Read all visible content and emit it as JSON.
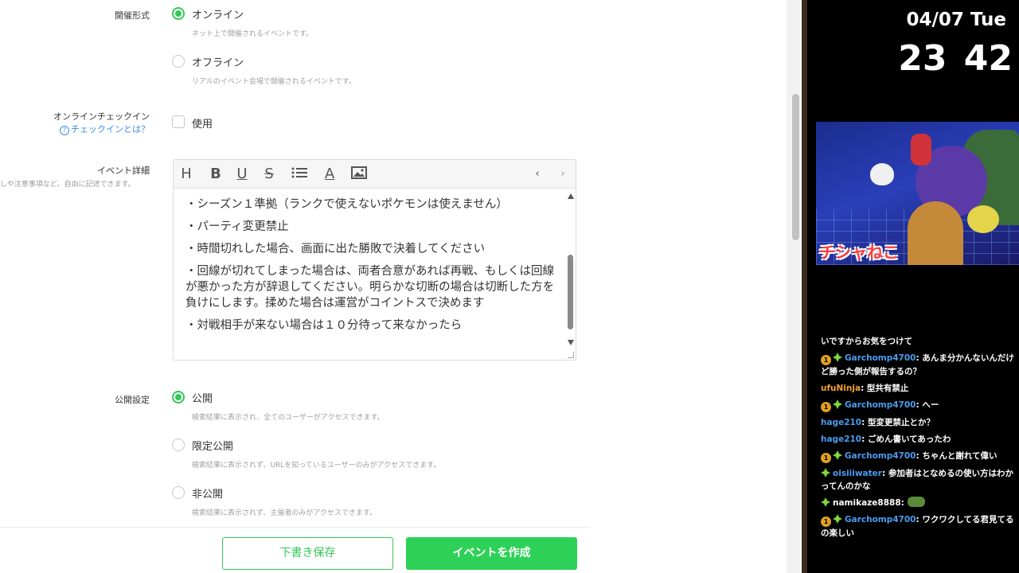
{
  "form": {
    "format_label": "開催形式",
    "format_options": [
      {
        "label": "オンライン",
        "desc": "ネット上で開催されるイベントです。",
        "selected": true
      },
      {
        "label": "オフライン",
        "desc": "リアルのイベント会場で開催されるイベントです。",
        "selected": false
      }
    ],
    "checkin_label": "オンラインチェックイン",
    "checkin_help": "チェックインとは？",
    "checkin_option": "使用",
    "detail_label": "イベント詳細",
    "detail_hint": "しや注意事項など、自由に記述できます。",
    "editor_content": [
      "・シーズン１準拠（ランクで使えないポケモンは使えません）",
      "・パーティ変更禁止",
      "・時間切れした場合、画面に出た勝敗で決着してください",
      "・回線が切れてしまった場合は、両者合意があれば再戦、もしくは回線が悪かった方が辞退してください。明らかな切断の場合は切断した方を負けにします。揉めた場合は運営がコイントスで決めます",
      "・対戦相手が来ない場合は１０分待って来なかったら"
    ],
    "visibility_label": "公開設定",
    "visibility_options": [
      {
        "label": "公開",
        "desc": "検索結果に表示され、全てのユーザーがアクセスできます。",
        "selected": true
      },
      {
        "label": "限定公開",
        "desc": "検索結果に表示されず、URLを知っているユーザーのみがアクセスできます。",
        "selected": false
      },
      {
        "label": "非公開",
        "desc": "検索結果に表示されず、主催者のみがアクセスできます。",
        "selected": false
      }
    ],
    "draft_button": "下書き保存",
    "create_button": "イベントを作成"
  },
  "toolbar_icons": [
    "heading-icon",
    "bold-icon",
    "underline-icon",
    "strikethrough-icon",
    "list-icon",
    "text-color-icon",
    "image-icon",
    "undo-icon",
    "redo-icon"
  ],
  "toolbar_glyphs": {
    "heading": "H",
    "bold": "B",
    "underline": "U",
    "strike": "S",
    "text_color": "A",
    "undo": "‹",
    "redo": "›"
  },
  "overlay": {
    "date": "04/07 Tue",
    "time": "23 42",
    "art_title": "チシャねこ"
  },
  "chat": [
    {
      "badge": "",
      "user": "",
      "text": "いですからお気をつけて",
      "color": ""
    },
    {
      "badge": "1",
      "user": "Garchomp4700",
      "text": ": あんま分かんないんだけど勝った側が報告するの？",
      "color": "blue"
    },
    {
      "badge": "",
      "user": "ufuNinja",
      "text": ": 型共有禁止",
      "color": "orange"
    },
    {
      "badge": "1",
      "user": "Garchomp4700",
      "text": ": へー",
      "color": "blue"
    },
    {
      "badge": "",
      "user": "hage210",
      "text": ": 型変更禁止とか？",
      "color": "blue"
    },
    {
      "badge": "",
      "user": "hage210",
      "text": ": ごめん書いてあったわ",
      "color": "blue"
    },
    {
      "badge": "1",
      "user": "Garchomp4700",
      "text": ": ちゃんと謝れて偉い",
      "color": "blue"
    },
    {
      "badge": "gem",
      "user": "oisiiiwater",
      "text": ": 参加者はとなめるの使い方はわかってんのかな",
      "color": "blue"
    },
    {
      "badge": "gem",
      "user": "namikaze8888",
      "text": ": ",
      "color": "white"
    },
    {
      "badge": "1",
      "user": "Garchomp4700",
      "text": ": ワクワクしてる君見てるの楽しい",
      "color": "blue"
    }
  ],
  "colors": {
    "accent": "#34c759",
    "link": "#3d8be8"
  }
}
